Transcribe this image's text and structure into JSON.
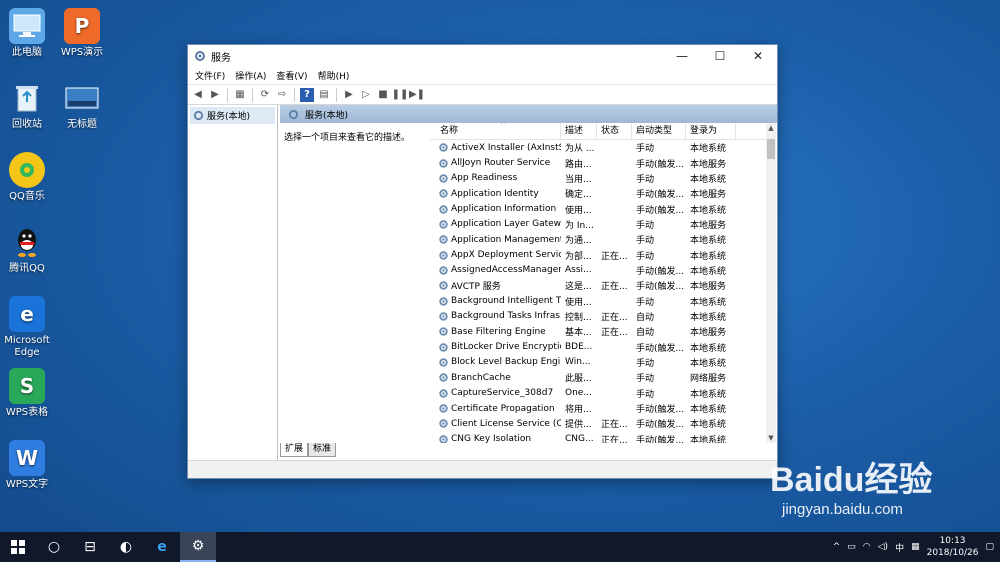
{
  "desktop": {
    "icons": [
      {
        "label": "此电脑",
        "icon": "computer-icon",
        "color": "#5fa8e8"
      },
      {
        "label": "WPS演示",
        "icon": "wps-presentation-icon",
        "color": "#f06a2a"
      },
      {
        "label": "回收站",
        "icon": "recycle-bin-icon",
        "color": "#cfe3f3"
      },
      {
        "label": "无标题",
        "icon": "file-thumbnail-icon",
        "color": "#3a7fc4"
      },
      {
        "label": "QQ音乐",
        "icon": "qq-music-icon",
        "color": "#f5c518"
      },
      {
        "label": "腾讯QQ",
        "icon": "qq-icon",
        "color": "#111111"
      },
      {
        "label": "Microsoft Edge",
        "icon": "edge-icon",
        "color": "#1a73d9"
      },
      {
        "label": "WPS表格",
        "icon": "wps-spreadsheet-icon",
        "color": "#2aa85a"
      },
      {
        "label": "WPS文字",
        "icon": "wps-writer-icon",
        "color": "#2f7de1"
      }
    ]
  },
  "window": {
    "title": "服务",
    "controls": {
      "minimize": "—",
      "maximize": "☐",
      "close": "✕"
    },
    "menu": [
      "文件(F)",
      "操作(A)",
      "查看(V)",
      "帮助(H)"
    ],
    "tree_item": "服务(本地)",
    "pane_header": "服务(本地)",
    "description_hint": "选择一个项目来查看它的描述。",
    "columns": {
      "name": "名称",
      "desc": "描述",
      "status": "状态",
      "startup": "启动类型",
      "logon": "登录为"
    },
    "services": [
      {
        "name": "ActiveX Installer (AxInstSV)",
        "desc": "为从 ...",
        "status": "",
        "startup": "手动",
        "logon": "本地系统"
      },
      {
        "name": "AllJoyn Router Service",
        "desc": "路由...",
        "status": "",
        "startup": "手动(触发...",
        "logon": "本地服务"
      },
      {
        "name": "App Readiness",
        "desc": "当用...",
        "status": "",
        "startup": "手动",
        "logon": "本地系统"
      },
      {
        "name": "Application Identity",
        "desc": "确定...",
        "status": "",
        "startup": "手动(触发...",
        "logon": "本地服务"
      },
      {
        "name": "Application Information",
        "desc": "使用...",
        "status": "",
        "startup": "手动(触发...",
        "logon": "本地系统"
      },
      {
        "name": "Application Layer Gatewa...",
        "desc": "为 In...",
        "status": "",
        "startup": "手动",
        "logon": "本地服务"
      },
      {
        "name": "Application Management",
        "desc": "为通...",
        "status": "",
        "startup": "手动",
        "logon": "本地系统"
      },
      {
        "name": "AppX Deployment Servic...",
        "desc": "为部...",
        "status": "正在...",
        "startup": "手动",
        "logon": "本地系统"
      },
      {
        "name": "AssignedAccessManager...",
        "desc": "Assi...",
        "status": "",
        "startup": "手动(触发...",
        "logon": "本地系统"
      },
      {
        "name": "AVCTP 服务",
        "desc": "这是...",
        "status": "正在...",
        "startup": "手动(触发...",
        "logon": "本地服务"
      },
      {
        "name": "Background Intelligent T...",
        "desc": "使用...",
        "status": "",
        "startup": "手动",
        "logon": "本地系统"
      },
      {
        "name": "Background Tasks Infras...",
        "desc": "控制...",
        "status": "正在...",
        "startup": "自动",
        "logon": "本地系统"
      },
      {
        "name": "Base Filtering Engine",
        "desc": "基本...",
        "status": "正在...",
        "startup": "自动",
        "logon": "本地服务"
      },
      {
        "name": "BitLocker Drive Encryptio...",
        "desc": "BDE...",
        "status": "",
        "startup": "手动(触发...",
        "logon": "本地系统"
      },
      {
        "name": "Block Level Backup Engi...",
        "desc": "Win...",
        "status": "",
        "startup": "手动",
        "logon": "本地系统"
      },
      {
        "name": "BranchCache",
        "desc": "此服...",
        "status": "",
        "startup": "手动",
        "logon": "网络服务"
      },
      {
        "name": "CaptureService_308d7",
        "desc": "One...",
        "status": "",
        "startup": "手动",
        "logon": "本地系统"
      },
      {
        "name": "Certificate Propagation",
        "desc": "将用...",
        "status": "",
        "startup": "手动(触发...",
        "logon": "本地系统"
      },
      {
        "name": "Client License Service (Cli...",
        "desc": "提供...",
        "status": "正在...",
        "startup": "手动(触发...",
        "logon": "本地系统"
      },
      {
        "name": "CNG Key Isolation",
        "desc": "CNG...",
        "status": "正在...",
        "startup": "手动(触发...",
        "logon": "本地系统"
      }
    ],
    "tabs": [
      "扩展",
      "标准"
    ]
  },
  "taskbar": {
    "tray": {
      "ime": "中",
      "time": "10:13",
      "date": "2018/10/26"
    }
  },
  "watermark": {
    "brand": "Baidu经验",
    "url": "jingyan.baidu.com"
  },
  "colors": {
    "selection": "#dde9f5",
    "header": "#9fb8d6",
    "taskbar": "#10182a"
  }
}
